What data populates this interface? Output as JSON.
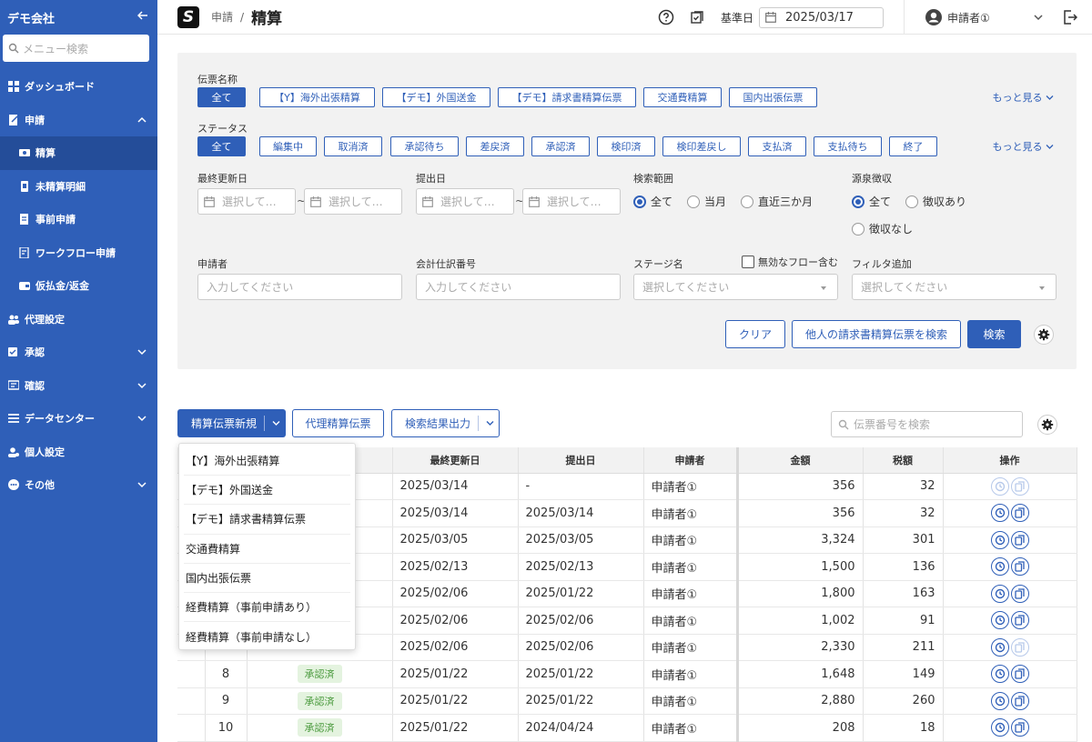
{
  "sidebar": {
    "company": "デモ会社",
    "search_placeholder": "メニュー検索",
    "items": [
      {
        "label": "ダッシュボード"
      },
      {
        "label": "申請"
      },
      {
        "label": "精算"
      },
      {
        "label": "未精算明細"
      },
      {
        "label": "事前申請"
      },
      {
        "label": "ワークフロー申請"
      },
      {
        "label": "仮払金/返金"
      },
      {
        "label": "代理設定"
      },
      {
        "label": "承認"
      },
      {
        "label": "確認"
      },
      {
        "label": "データセンター"
      },
      {
        "label": "個人設定"
      },
      {
        "label": "その他"
      }
    ]
  },
  "topbar": {
    "logo_letter": "S",
    "breadcrumb_parent": "申請",
    "breadcrumb_sep": "/",
    "page_title": "精算",
    "base_date_label": "基準日",
    "base_date": "2025/03/17",
    "user_name": "申請者①"
  },
  "filters": {
    "voucher_label": "伝票名称",
    "voucher_chips": [
      "全て",
      "【Y】海外出張精算",
      "【デモ】外国送金",
      "【デモ】請求書精算伝票",
      "交通費精算",
      "国内出張伝票"
    ],
    "status_label": "ステータス",
    "status_chips": [
      "全て",
      "編集中",
      "取消済",
      "承認待ち",
      "差戻済",
      "承認済",
      "検印済",
      "検印差戻し",
      "支払済",
      "支払待ち",
      "終了"
    ],
    "more": "もっと見る",
    "last_updated_label": "最終更新日",
    "submitted_label": "提出日",
    "date_placeholder": "選択して…",
    "tilde": "~",
    "search_range_label": "検索範囲",
    "search_range_options": [
      "全て",
      "当月",
      "直近三か月"
    ],
    "withholding_label": "源泉徴収",
    "withholding_options": [
      "全て",
      "徴収あり",
      "徴収なし"
    ],
    "applicant_label": "申請者",
    "applicant_placeholder": "入力してください",
    "journal_label": "会計仕訳番号",
    "journal_placeholder": "入力してください",
    "stage_label": "ステージ名",
    "stage_placeholder": "選択してください",
    "invalid_flow_label": "無効なフロー含む",
    "add_filter_label": "フィルタ追加",
    "add_filter_placeholder": "選択してください",
    "clear_button": "クリア",
    "others_button": "他人の請求書精算伝票を検索",
    "search_button": "検索"
  },
  "actions": {
    "new_button": "精算伝票新規",
    "proxy_button": "代理精算伝票",
    "export_button": "検索結果出力",
    "search_placeholder": "伝票番号を検索"
  },
  "new_menu": [
    "【Y】海外出張精算",
    "【デモ】外国送金",
    "【デモ】請求書精算伝票",
    "交通費精算",
    "国内出張伝票",
    "経費精算（事前申請あり）",
    "経費精算（事前申請なし）"
  ],
  "table": {
    "headers": {
      "updated": "最終更新日",
      "submitted": "提出日",
      "applicant": "申請者",
      "amount": "金額",
      "tax": "税額",
      "ops": "操作"
    },
    "rows": [
      {
        "no": "",
        "status": "",
        "updated": "2025/03/14",
        "submitted": "-",
        "applicant": "申請者①",
        "amount": "356",
        "tax": "32"
      },
      {
        "no": "",
        "status": "",
        "updated": "2025/03/14",
        "submitted": "2025/03/14",
        "applicant": "申請者①",
        "amount": "356",
        "tax": "32"
      },
      {
        "no": "",
        "status": "",
        "updated": "2025/03/05",
        "submitted": "2025/03/05",
        "applicant": "申請者①",
        "amount": "3,324",
        "tax": "301"
      },
      {
        "no": "",
        "status": "",
        "updated": "2025/02/13",
        "submitted": "2025/02/13",
        "applicant": "申請者①",
        "amount": "1,500",
        "tax": "136"
      },
      {
        "no": "",
        "status": "",
        "updated": "2025/02/06",
        "submitted": "2025/01/22",
        "applicant": "申請者①",
        "amount": "1,800",
        "tax": "163"
      },
      {
        "no": "",
        "status": "",
        "updated": "2025/02/06",
        "submitted": "2025/02/06",
        "applicant": "申請者①",
        "amount": "1,002",
        "tax": "91"
      },
      {
        "no": "",
        "status": "",
        "updated": "2025/02/06",
        "submitted": "2025/02/06",
        "applicant": "申請者①",
        "amount": "2,330",
        "tax": "211"
      },
      {
        "no": "8",
        "status": "承認済",
        "updated": "2025/01/22",
        "submitted": "2025/01/22",
        "applicant": "申請者①",
        "amount": "1,648",
        "tax": "149"
      },
      {
        "no": "9",
        "status": "承認済",
        "updated": "2025/01/22",
        "submitted": "2025/01/22",
        "applicant": "申請者①",
        "amount": "2,880",
        "tax": "260"
      },
      {
        "no": "10",
        "status": "承認済",
        "updated": "2025/01/22",
        "submitted": "2024/04/24",
        "applicant": "申請者①",
        "amount": "208",
        "tax": "18"
      }
    ]
  },
  "colors": {
    "sidebar": "#2f5fb8",
    "primary": "#2f5fb8",
    "badge_bg": "#e4f3df",
    "badge_text": "#4a9a3d"
  }
}
